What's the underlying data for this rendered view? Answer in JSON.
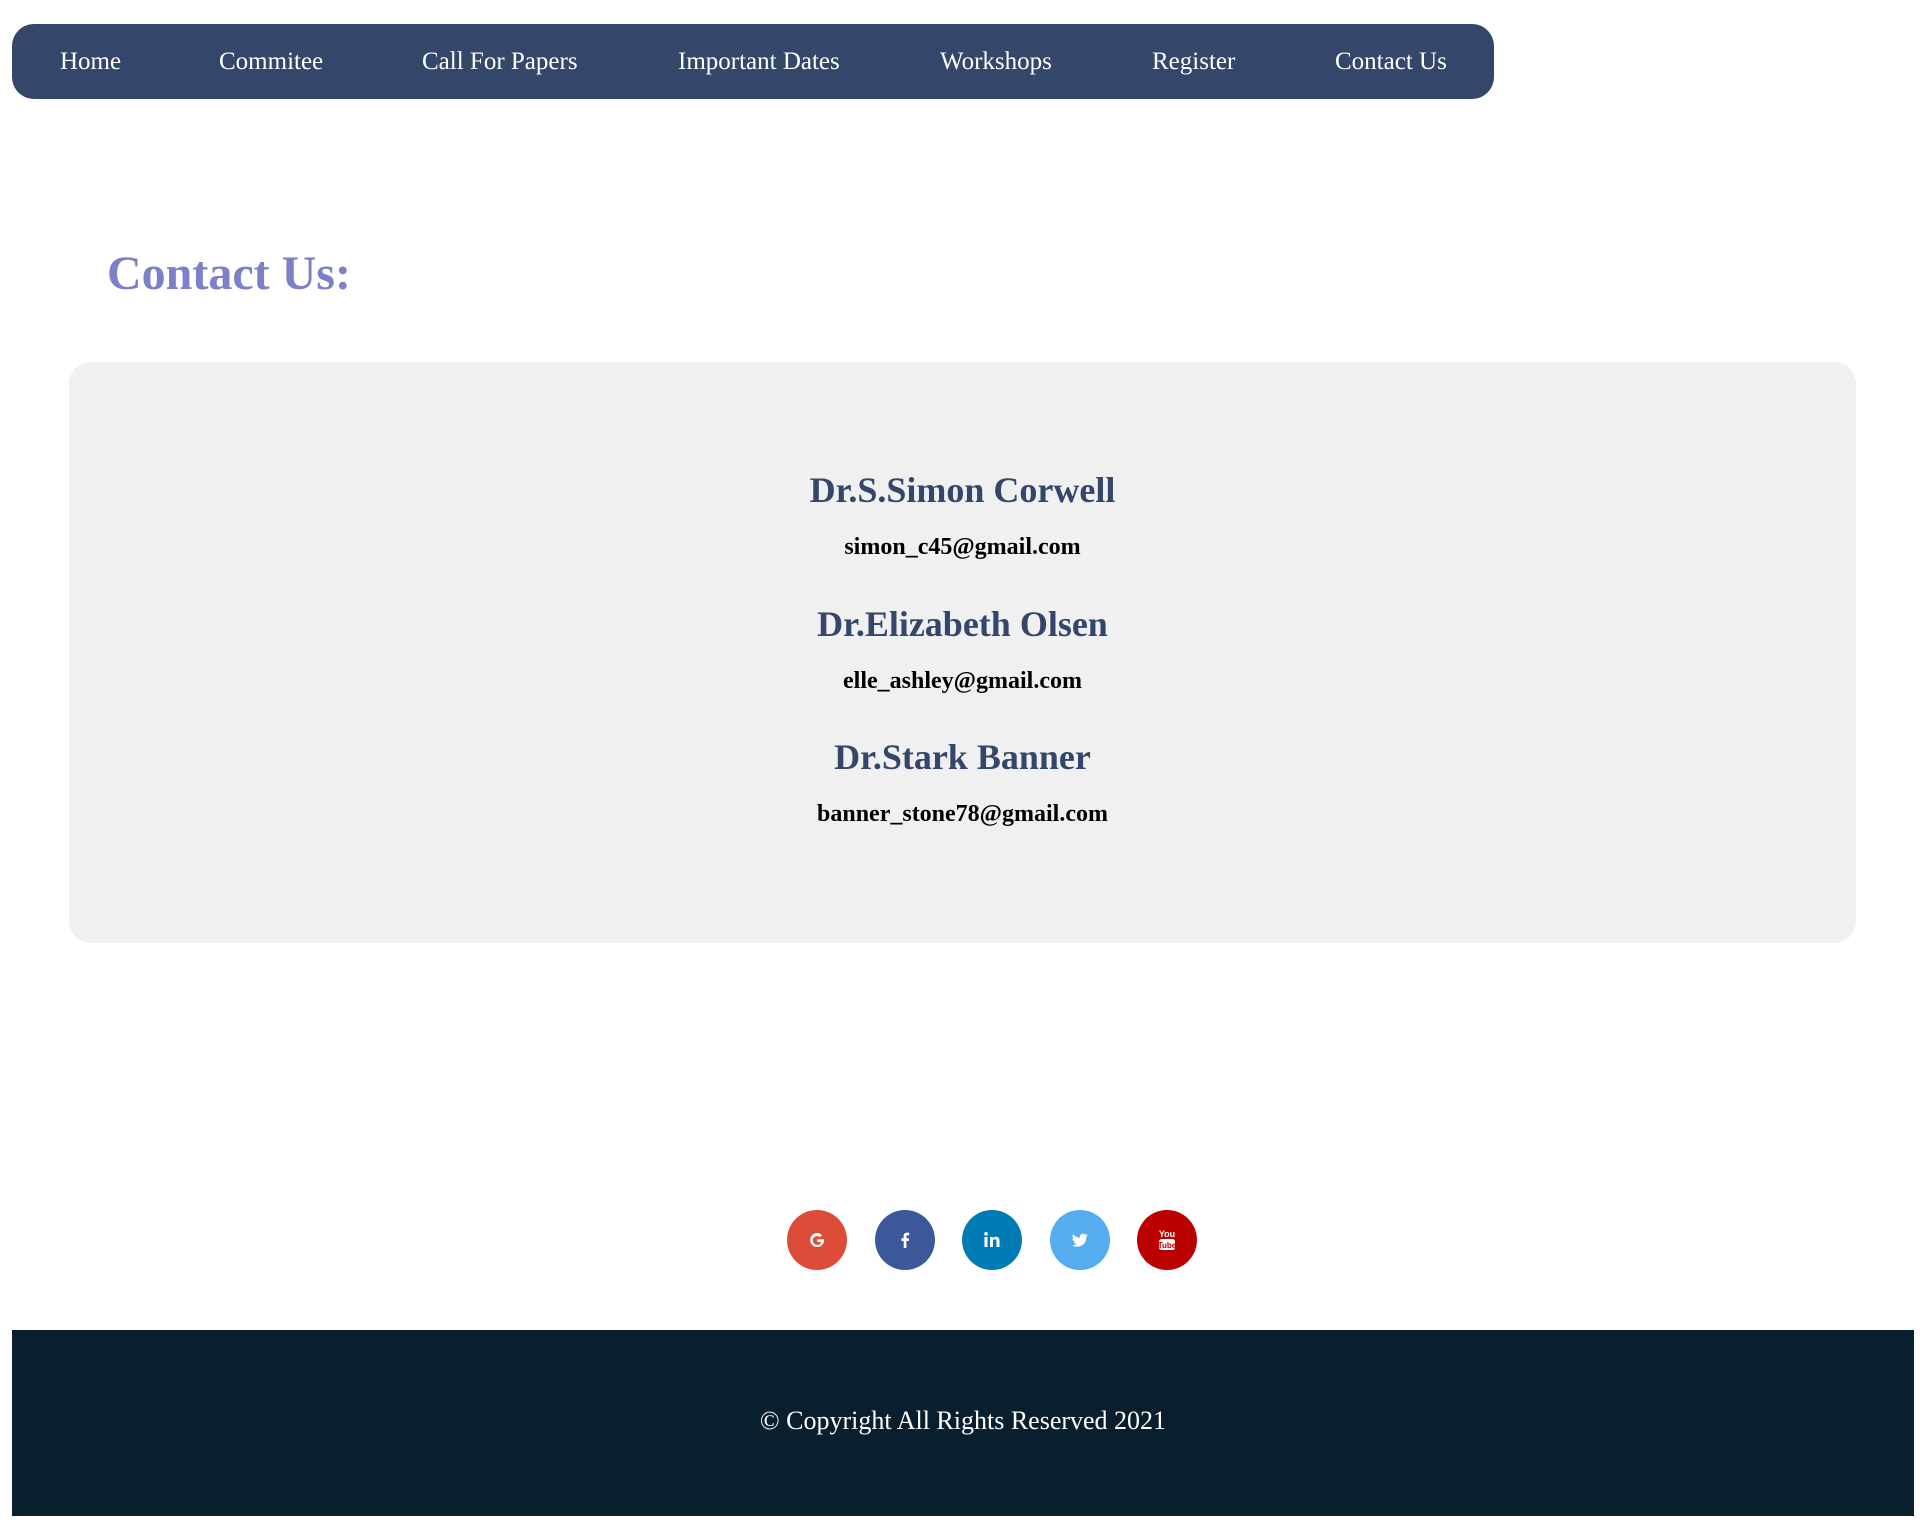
{
  "colors": {
    "nav_bg": "#344669",
    "title": "#7b80c8",
    "contact_name": "#344669",
    "card_bg": "#f0f0f0",
    "footer_bg": "#0a1f2e"
  },
  "nav": {
    "items": [
      {
        "label": "Home"
      },
      {
        "label": "Commitee"
      },
      {
        "label": "Call For Papers"
      },
      {
        "label": "Important Dates"
      },
      {
        "label": "Workshops"
      },
      {
        "label": "Register"
      },
      {
        "label": "Contact Us"
      }
    ]
  },
  "page": {
    "title": "Contact Us:"
  },
  "contacts": [
    {
      "name": "Dr.S.Simon Corwell",
      "email": "simon_c45@gmail.com"
    },
    {
      "name": "Dr.Elizabeth Olsen",
      "email": "elle_ashley@gmail.com"
    },
    {
      "name": "Dr.Stark Banner",
      "email": "banner_stone78@gmail.com"
    }
  ],
  "social": [
    {
      "icon": "google-icon",
      "color": "#dd4b39"
    },
    {
      "icon": "facebook-icon",
      "color": "#3b5998"
    },
    {
      "icon": "linkedin-icon",
      "color": "#007bb5"
    },
    {
      "icon": "twitter-icon",
      "color": "#55acee"
    },
    {
      "icon": "youtube-icon",
      "color": "#bb0000"
    }
  ],
  "footer": {
    "copyright": "© Copyright All Rights Reserved 2021"
  }
}
